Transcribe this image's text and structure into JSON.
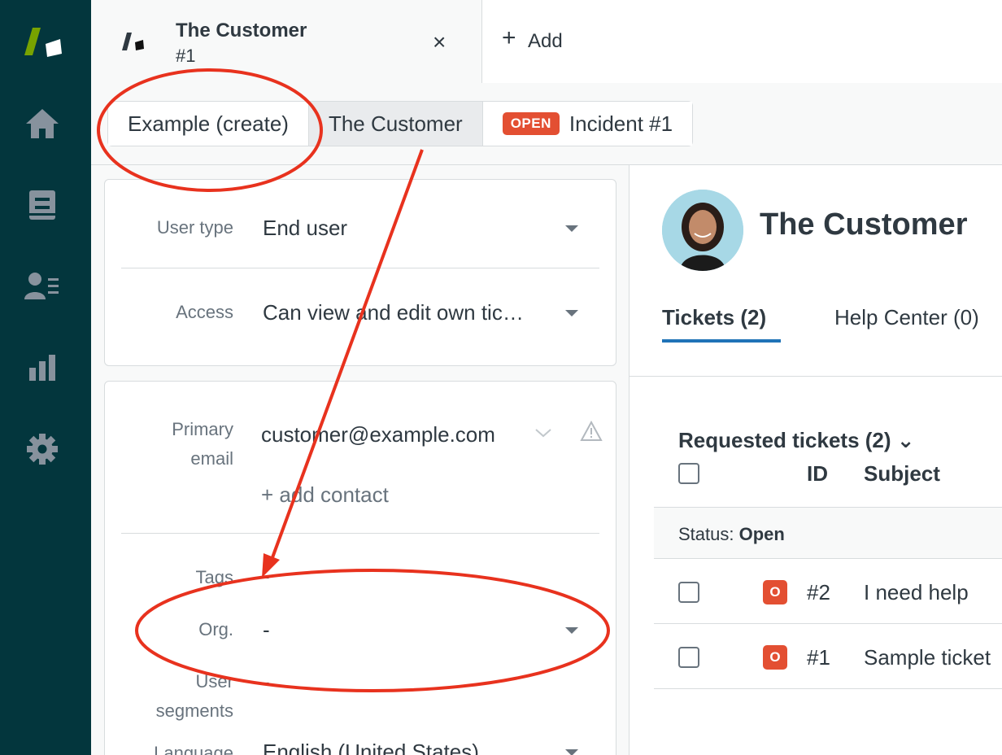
{
  "nav": {
    "items": [
      {
        "icon": "home-icon"
      },
      {
        "icon": "views-icon"
      },
      {
        "icon": "customers-icon"
      },
      {
        "icon": "reporting-icon"
      },
      {
        "icon": "settings-icon"
      }
    ]
  },
  "tabs": {
    "active": {
      "title": "The Customer",
      "subtitle": "#1",
      "close": "×"
    },
    "add": {
      "plus": "+",
      "label": "Add"
    }
  },
  "breadcrumb": {
    "items": [
      {
        "label": "Example (create)"
      },
      {
        "label": "The Customer"
      },
      {
        "badge": "OPEN",
        "label": "Incident #1"
      }
    ]
  },
  "user_fields": {
    "user_type": {
      "label": "User type",
      "value": "End user"
    },
    "access": {
      "label": "Access",
      "value": "Can view and edit own tic…"
    }
  },
  "contact_fields": {
    "primary_email": {
      "label_line1": "Primary",
      "label_line2": "email",
      "value": "customer@example.com"
    },
    "add_contact": "+ add contact",
    "tags": {
      "label": "Tags",
      "value": "-"
    },
    "org": {
      "label": "Org.",
      "value": "-"
    },
    "user_segments": {
      "label_line1": "User",
      "label_line2": "segments",
      "value": "-"
    },
    "language": {
      "label": "Language",
      "value": "English (United States)"
    }
  },
  "profile": {
    "name": "The Customer",
    "tabs": [
      {
        "label": "Tickets (2)"
      },
      {
        "label": "Help Center (0)"
      }
    ]
  },
  "tickets": {
    "title": "Requested tickets (2) ⌄",
    "columns": {
      "id": "ID",
      "subject": "Subject"
    },
    "status_prefix": "Status:",
    "status_value": "Open",
    "rows": [
      {
        "badge": "O",
        "id": "#2",
        "subject": "I need help"
      },
      {
        "badge": "O",
        "id": "#1",
        "subject": "Sample ticket"
      }
    ]
  },
  "colors": {
    "nav_bg": "#03363d",
    "open_badge": "#e34f32",
    "tab_underline": "#1f73b7",
    "annotation": "#e8321e"
  }
}
